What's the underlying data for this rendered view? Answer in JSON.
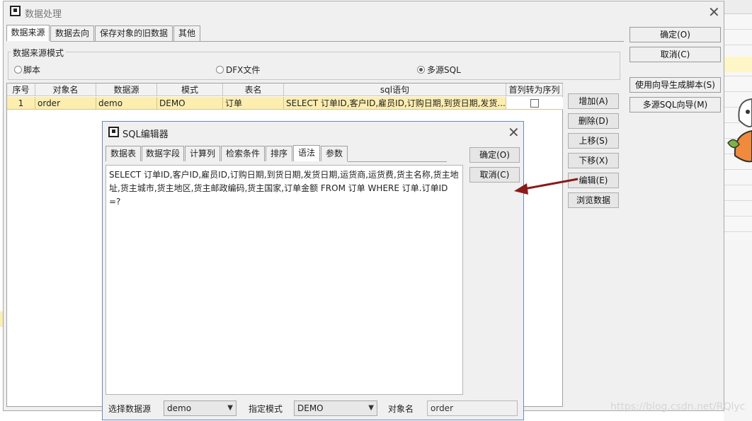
{
  "dialog": {
    "title": "数据处理"
  },
  "tabs": [
    "数据来源",
    "数据去向",
    "保存对象的旧数据",
    "其他"
  ],
  "source_mode": {
    "label": "数据来源模式",
    "options": [
      "脚本",
      "DFX文件",
      "多源SQL"
    ],
    "selected": "多源SQL"
  },
  "right_buttons": {
    "ok": "确定(O)",
    "cancel": "取消(C)",
    "wizard_script": "使用向导生成脚本(S)",
    "multi_sql_wizard": "多源SQL向导(M)"
  },
  "table": {
    "columns": [
      "序号",
      "对象名",
      "数据源",
      "模式",
      "表名",
      "sql语句",
      "首列转为序列"
    ],
    "rows": [
      {
        "no": "1",
        "object": "order",
        "datasource": "demo",
        "schema": "DEMO",
        "table": "订单",
        "sql": "SELECT 订单ID,客户ID,雇员ID,订购日期,到货日期,发货...",
        "first_col_seq": false
      }
    ]
  },
  "side_buttons": {
    "add": "增加(A)",
    "delete": "删除(D)",
    "up": "上移(S)",
    "down": "下移(X)",
    "edit": "编辑(E)",
    "browse": "浏览数据"
  },
  "sql_editor": {
    "title": "SQL编辑器",
    "tabs": [
      "数据表",
      "数据字段",
      "计算列",
      "检索条件",
      "排序",
      "语法",
      "参数"
    ],
    "active_tab": "语法",
    "ok": "确定(O)",
    "cancel": "取消(C)",
    "sql_line1": "SELECT 订单ID,客户ID,雇员ID,订购日期,到货日期,发货日期,运货商,运货费,货主名称,货主地",
    "sql_line2": "址,货主城市,货主地区,货主邮政编码,货主国家,订单金额 FROM 订单 WHERE 订单.订单ID =?",
    "datasource_label": "选择数据源",
    "datasource_value": "demo",
    "schema_label": "指定模式",
    "schema_value": "DEMO",
    "object_label": "对象名",
    "object_value": "order"
  },
  "watermark": "https://blog.csdn.net/RQlyc",
  "colors": {
    "selected_row": "#fdeeb0",
    "arrow": "#8b1a1a"
  },
  "icons": [
    "app-logo-icon",
    "close-icon",
    "chevron-down-icon",
    "arrow-icon"
  ]
}
